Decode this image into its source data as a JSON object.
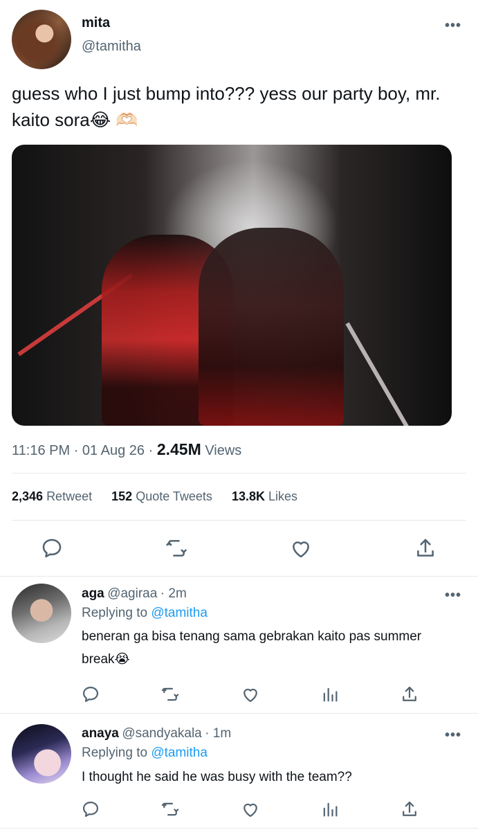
{
  "tweet": {
    "author_name": "mita",
    "author_handle": "@tamitha",
    "more_label": "•••",
    "text": "guess who I just bump into??? yess our party boy, mr. kaito sora😂 🫶🏻",
    "time": "11:16 PM",
    "date": "01 Aug 26",
    "separator": "·",
    "views_count": "2.45M",
    "views_label": "Views"
  },
  "stats": {
    "retweets_count": "2,346",
    "retweets_label": "Retweet",
    "quotes_count": "152",
    "quotes_label": "Quote Tweets",
    "likes_count": "13.8K",
    "likes_label": "Likes"
  },
  "actions": [
    "reply-icon",
    "retweet-icon",
    "like-icon",
    "share-icon"
  ],
  "replies": [
    {
      "name": "aga",
      "handle": "@agiraa",
      "time": "· 2m",
      "replying_label": "Replying to",
      "replying_to": "@tamitha",
      "text": "beneran ga bisa tenang sama gebrakan kaito pas summer break😭",
      "more_label": "•••"
    },
    {
      "name": "anaya",
      "handle": "@sandyakala",
      "time": "· 1m",
      "replying_label": "Replying to",
      "replying_to": "@tamitha",
      "text": "I thought he said he was busy with the team??",
      "more_label": "•••"
    }
  ],
  "colors": {
    "text": "#0f1419",
    "secondary": "#536471",
    "link": "#1d9bf0",
    "divider": "#e6e9ec"
  }
}
